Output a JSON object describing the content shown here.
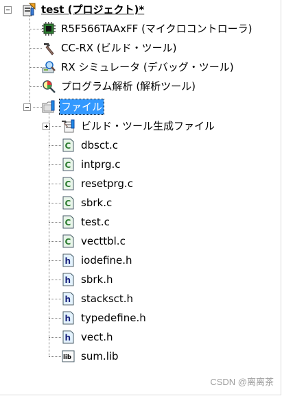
{
  "tree": {
    "project": {
      "label": "test (プロジェクト)*",
      "icon": "project-icon"
    },
    "children": [
      {
        "label": "R5F566TAAxFF (マイクロコントローラ)",
        "icon": "microcontroller-chip-icon"
      },
      {
        "label": "CC-RX (ビルド・ツール)",
        "icon": "hammer-build-tool-icon"
      },
      {
        "label": "RX シミュレータ (デバッグ・ツール)",
        "icon": "debug-simulator-icon"
      },
      {
        "label": "プログラム解析 (解析ツール)",
        "icon": "analysis-magnifier-icon"
      },
      {
        "label": "ファイル",
        "icon": "file-folder-icon"
      }
    ],
    "files": [
      {
        "label": "ビルド・ツール生成ファイル",
        "icon": "build-generated-folder-icon"
      },
      {
        "label": "dbsct.c",
        "icon": "c-source-file-icon"
      },
      {
        "label": "intprg.c",
        "icon": "c-source-file-icon"
      },
      {
        "label": "resetprg.c",
        "icon": "c-source-file-icon"
      },
      {
        "label": "sbrk.c",
        "icon": "c-source-file-icon"
      },
      {
        "label": "test.c",
        "icon": "c-source-file-icon"
      },
      {
        "label": "vecttbl.c",
        "icon": "c-source-file-icon"
      },
      {
        "label": "iodefine.h",
        "icon": "h-header-file-icon"
      },
      {
        "label": "sbrk.h",
        "icon": "h-header-file-icon"
      },
      {
        "label": "stacksct.h",
        "icon": "h-header-file-icon"
      },
      {
        "label": "typedefine.h",
        "icon": "h-header-file-icon"
      },
      {
        "label": "vect.h",
        "icon": "h-header-file-icon"
      },
      {
        "label": "sum.lib",
        "icon": "lib-file-icon"
      }
    ]
  },
  "watermark": "CSDN @离离茶"
}
